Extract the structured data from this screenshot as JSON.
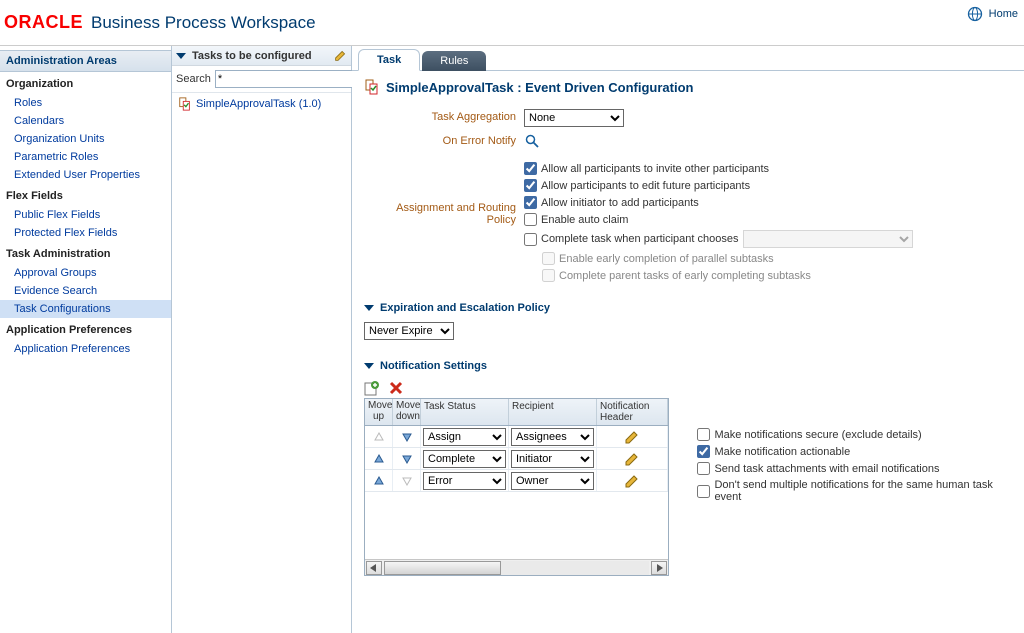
{
  "header": {
    "brand": "ORACLE",
    "title": "Business Process Workspace",
    "home": "Home"
  },
  "sidebar": {
    "title": "Administration Areas",
    "groups": [
      {
        "label": "Organization",
        "items": [
          "Roles",
          "Calendars",
          "Organization Units",
          "Parametric Roles",
          "Extended User Properties"
        ]
      },
      {
        "label": "Flex Fields",
        "items": [
          "Public Flex Fields",
          "Protected Flex Fields"
        ]
      },
      {
        "label": "Task Administration",
        "items": [
          "Approval Groups",
          "Evidence Search",
          "Task Configurations"
        ],
        "selected": 2
      },
      {
        "label": "Application Preferences",
        "items": [
          "Application Preferences"
        ]
      }
    ]
  },
  "mid": {
    "title": "Tasks to be configured",
    "search_label": "Search",
    "search_value": "*",
    "task_name": "SimpleApprovalTask (1.0)"
  },
  "tabs": {
    "task": "Task",
    "rules": "Rules"
  },
  "page": {
    "heading": "SimpleApprovalTask : Event Driven Configuration",
    "task_agg_label": "Task Aggregation",
    "task_agg_value": "None",
    "on_error_label": "On Error Notify",
    "assign_label": "Assignment and Routing Policy",
    "assign_opts": {
      "invite": "Allow all participants to invite other participants",
      "edit_future": "Allow participants to edit future participants",
      "initiator_add": "Allow initiator to add participants",
      "auto_claim": "Enable auto claim",
      "complete_choose": "Complete task when participant chooses",
      "early_parallel": "Enable early completion of parallel subtasks",
      "parent_early": "Complete parent tasks of early completing subtasks"
    },
    "expiration": {
      "heading": "Expiration and Escalation Policy",
      "value": "Never Expire"
    },
    "notif": {
      "heading": "Notification Settings",
      "cols": {
        "move_up": "Move up",
        "move_dw": "Move down",
        "status": "Task Status",
        "recipient": "Recipient",
        "header": "Notification Header"
      },
      "rows": [
        {
          "status": "Assign",
          "recipient": "Assignees"
        },
        {
          "status": "Complete",
          "recipient": "Initiator"
        },
        {
          "status": "Error",
          "recipient": "Owner"
        }
      ],
      "side": {
        "secure": "Make notifications secure (exclude details)",
        "actionable": "Make notification actionable",
        "attach": "Send task attachments with email notifications",
        "no_dup": "Don't send multiple notifications for the same human task event"
      }
    }
  }
}
